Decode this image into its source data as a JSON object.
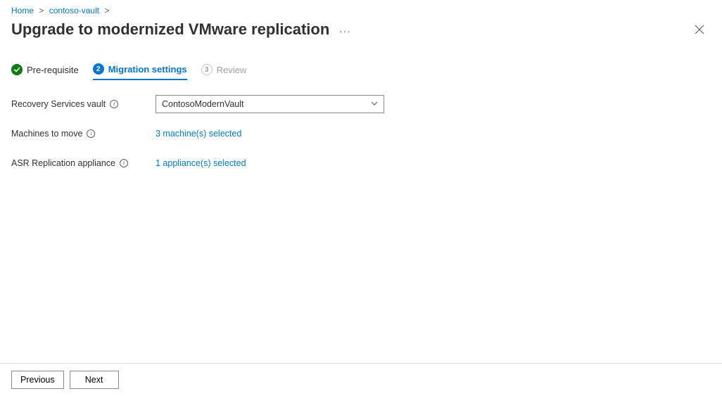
{
  "breadcrumb": {
    "items": [
      {
        "label": "Home"
      },
      {
        "label": "contoso-vault"
      }
    ]
  },
  "header": {
    "title": "Upgrade to modernized VMware replication"
  },
  "steps": {
    "s1": {
      "label": "Pre-requisite"
    },
    "s2": {
      "num": "2",
      "label": "Migration settings"
    },
    "s3": {
      "num": "3",
      "label": "Review"
    }
  },
  "form": {
    "vault": {
      "label": "Recovery Services vault",
      "value": "ContosoModernVault"
    },
    "machines": {
      "label": "Machines to move",
      "value": "3 machine(s) selected"
    },
    "appliance": {
      "label": "ASR Replication appliance",
      "value": "1 appliance(s) selected"
    }
  },
  "footer": {
    "previous": "Previous",
    "next": "Next"
  }
}
